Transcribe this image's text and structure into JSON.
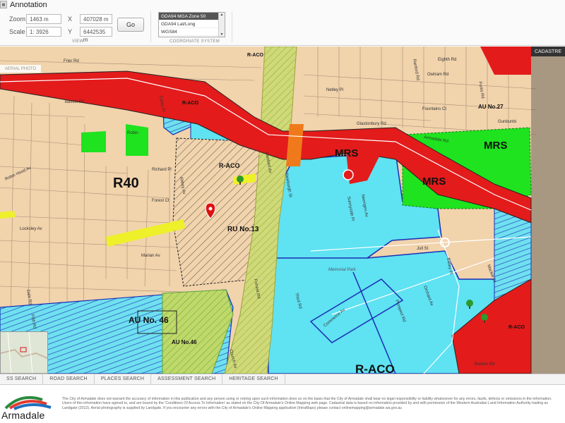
{
  "header": {
    "tab_title": "Annotation",
    "menu_icon": "grid-icon",
    "zoom_label": "Zoom",
    "zoom_value": "1463 m",
    "scale_label": "Scale",
    "scale_value": "1: 3926",
    "x_label": "X",
    "x_value": "407028 m",
    "y_label": "Y",
    "y_value": "6442535 m",
    "go_label": "Go",
    "view_caption": "VIEW",
    "coord_caption": "COORDINATE SYSTEM",
    "coord_options": [
      "GDA94 MGA Zone 50",
      "GDA94 Lat/Long",
      "WGS84"
    ]
  },
  "map": {
    "aerial_tab": "AERIAL PHOTO",
    "cadastre_tab": "CADASTRE",
    "zone_labels": [
      "R40",
      "MRS",
      "MRS",
      "MRS",
      "R-ACO",
      "R-ACO",
      "R-ACO",
      "R-ACO",
      "AU No. 46",
      "AU No.46",
      "RU No.13",
      "AU No.27",
      "R-ACO"
    ],
    "park_label": "Memorial Park",
    "streets": [
      "Frier Rd",
      "Bavich Rd",
      "Robin",
      "Richard Pl",
      "Robin Hood Av",
      "Forest Ct",
      "Locksley Av",
      "Marian Av",
      "Dale Rd",
      "Fifth Rd",
      "Netley Pl",
      "Owtram Rd",
      "Fountains Ct",
      "Glastonbury Rd",
      "Armadale Rd",
      "Forrest Rd",
      "Jull St",
      "Third Rd",
      "Prospect Rd",
      "Church Av",
      "Abbey Av",
      "Lambert Av",
      "Carey Pl",
      "Newburgh St",
      "Sunnyside Pl",
      "Batley Pl",
      "Fortis Rd",
      "Gunbunbi",
      "Ranford Rd",
      "Orchard Av",
      "Commerce Av",
      "Mackie St",
      "Neerigen Av",
      "Barken Rd",
      "Eighth Rd"
    ]
  },
  "search_tabs": [
    "SS SEARCH",
    "ROAD SEARCH",
    "PLACES SEARCH",
    "ASSESSMENT SEARCH",
    "HERITAGE SEARCH"
  ],
  "footer": {
    "logo_text": "Armadale",
    "disclaimer": "The City of Armadale does not warrant the accuracy of information in this publication and any person using or relying upon such information does so on the basis that the City of Armadale shall bear no legal responsibility or liability whatsoever for any errors, faults, defects or omissions in the information. Users of this information have agreed to, and are bound by the 'Conditions Of Access To Information' as stated on the City Of Armadale's Online Mapping web page. Cadastral data is based on information provided by and with permission of the Western Australian Land Information Authority trading as Landgate (2012). Aerial photography is supplied by Landgate. If you encounter any errors with the City of Armadale's Online Mapping application (IntraMaps) please contact onlinemapping@armadale.wa.gov.au"
  },
  "colors": {
    "residential": "#f1d3ac",
    "mrs_road": "#e31b1b",
    "mrs_green": "#1ee31e",
    "aco_blue": "#5fe2f2",
    "rail_yellow": "#c9d96b",
    "zone_border": "#1a2fb5"
  }
}
